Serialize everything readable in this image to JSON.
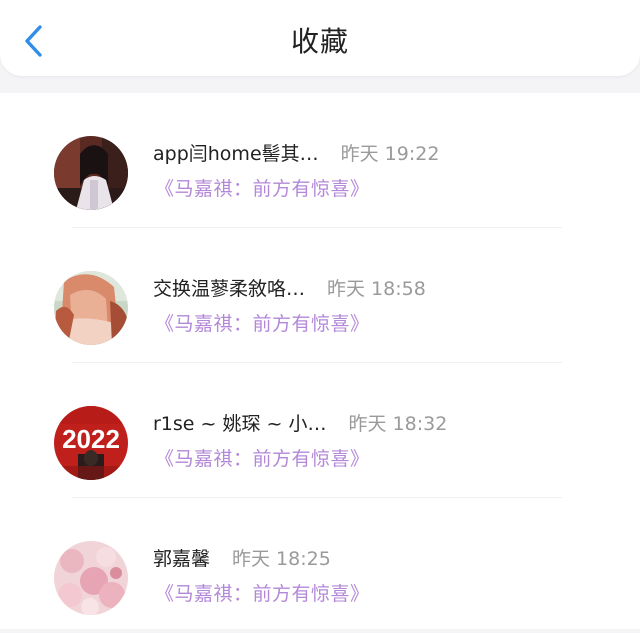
{
  "header": {
    "title": "收藏",
    "back_icon": "chevron-left-icon",
    "accent_color": "#2f8ee8"
  },
  "items": [
    {
      "name": "app闫home髻其…",
      "time": "昨天 19:22",
      "subtitle": "《马嘉祺：前方有惊喜》"
    },
    {
      "name": "交换温蓼柔敘咯…",
      "time": "昨天 18:58",
      "subtitle": "《马嘉祺：前方有惊喜》"
    },
    {
      "name": "r1se ~ 姚琛 ~ 小…",
      "time": "昨天 18:32",
      "subtitle": "《马嘉祺：前方有惊喜》",
      "avatar_text": "2022"
    },
    {
      "name": "郭嘉馨",
      "time": "昨天 18:25",
      "subtitle": "《马嘉祺：前方有惊喜》"
    }
  ],
  "colors": {
    "subtitle": "#b388d8",
    "time": "#9a9a9a"
  }
}
